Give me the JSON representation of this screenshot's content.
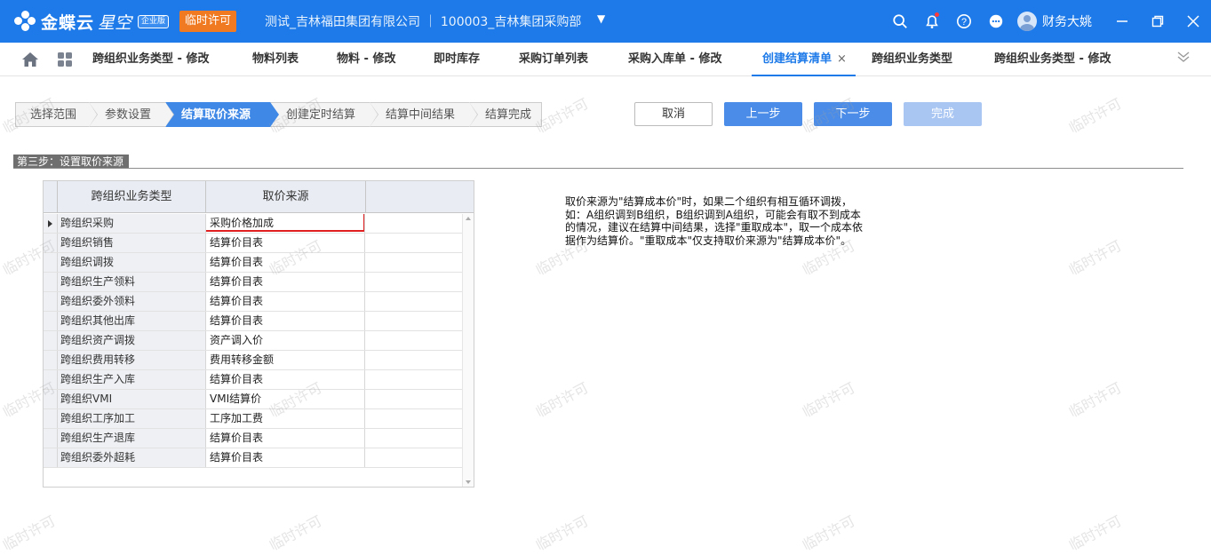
{
  "header": {
    "logo_text": "金蝶云",
    "logo_sub": "星空",
    "edition": "企业版",
    "license": "临时许可",
    "company": "测试_吉林福田集团有限公司  ｜  100003_吉林集团采购部",
    "user_name": "财务大姚"
  },
  "tabs": [
    {
      "label": "跨组织业务类型 - 修改"
    },
    {
      "label": "物料列表"
    },
    {
      "label": "物料 - 修改"
    },
    {
      "label": "即时库存"
    },
    {
      "label": "采购订单列表"
    },
    {
      "label": "采购入库单 - 修改"
    },
    {
      "label": "创建结算清单",
      "close": "×"
    },
    {
      "label": "跨组织业务类型"
    },
    {
      "label": "跨组织业务类型 - 修改"
    }
  ],
  "wizard": {
    "steps": [
      "选择范围",
      "参数设置",
      "结算取价来源",
      "创建定时结算",
      "结算中间结果",
      "结算完成"
    ],
    "current_step": 2,
    "buttons": {
      "cancel": "取消",
      "prev": "上一步",
      "next": "下一步",
      "finish": "完成"
    }
  },
  "section_title": "第三步：设置取价来源",
  "grid": {
    "columns": [
      "跨组织业务类型",
      "取价来源"
    ],
    "rows": [
      {
        "type": "跨组织采购",
        "source": "采购价格加成"
      },
      {
        "type": "跨组织销售",
        "source": "结算价目表"
      },
      {
        "type": "跨组织调拨",
        "source": "结算价目表"
      },
      {
        "type": "跨组织生产领料",
        "source": "结算价目表"
      },
      {
        "type": "跨组织委外领料",
        "source": "结算价目表"
      },
      {
        "type": "跨组织其他出库",
        "source": "结算价目表"
      },
      {
        "type": "跨组织资产调拨",
        "source": "资产调入价"
      },
      {
        "type": "跨组织费用转移",
        "source": "费用转移金额"
      },
      {
        "type": "跨组织生产入库",
        "source": "结算价目表"
      },
      {
        "type": "跨组织VMI",
        "source": "VMI结算价"
      },
      {
        "type": "跨组织工序加工",
        "source": "工序加工费"
      },
      {
        "type": "跨组织生产退库",
        "source": "结算价目表"
      },
      {
        "type": "跨组织委外超耗",
        "source": "结算价目表"
      }
    ]
  },
  "note": "取价来源为\"结算成本价\"时，如果二个组织有相互循环调拨，如：A组织调到B组织，B组织调到A组织，可能会有取不到成本的情况，建议在结算中间结果，选择\"重取成本\"，取一个成本依据作为结算价。\"重取成本\"仅支持取价来源为\"结算成本价\"。",
  "watermark": "临时许可"
}
